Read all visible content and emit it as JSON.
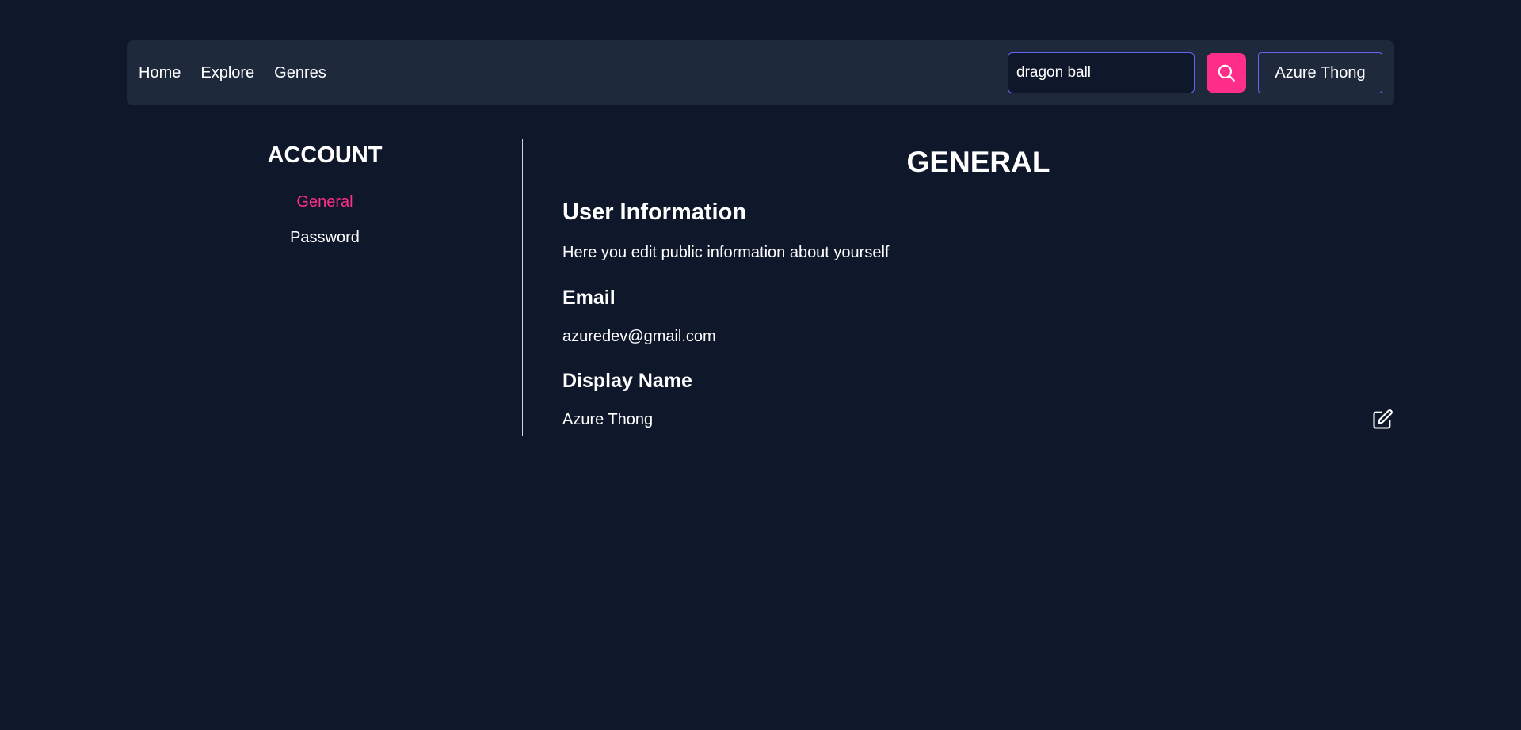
{
  "nav": {
    "links": [
      "Home",
      "Explore",
      "Genres"
    ],
    "search_value": "dragon ball",
    "search_icon": "search-icon",
    "user_label": "Azure Thong"
  },
  "sidebar": {
    "title": "ACCOUNT",
    "items": [
      {
        "label": "General",
        "active": true
      },
      {
        "label": "Password",
        "active": false
      }
    ]
  },
  "main": {
    "title": "GENERAL",
    "section_heading": "User Information",
    "section_description": "Here you edit public information about yourself",
    "email_label": "Email",
    "email_value": "azuredev@gmail.com",
    "display_name_label": "Display Name",
    "display_name_value": "Azure Thong",
    "edit_icon": "edit-icon"
  },
  "colors": {
    "background": "#0f172a",
    "navbar": "#1e293b",
    "accent": "#ff2e8a",
    "outline": "#6366f1"
  }
}
